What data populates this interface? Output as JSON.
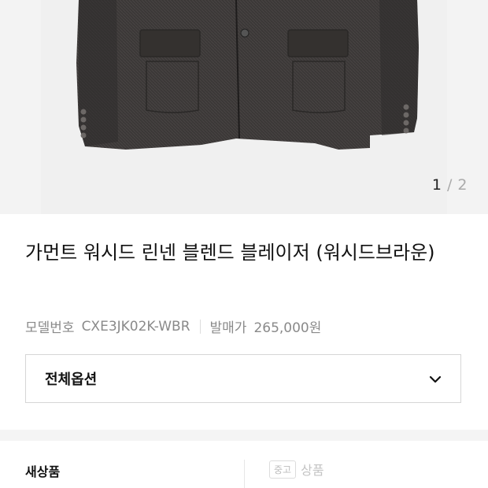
{
  "gallery": {
    "current": "1",
    "separator": "/",
    "total": "2"
  },
  "product": {
    "title": "가먼트 워시드 린넨 블렌드 블레이저 (워시드브라운)",
    "model_label": "모델번호",
    "model_value": "CXE3JK02K-WBR",
    "price_label": "발매가",
    "price_value": "265,000원"
  },
  "options": {
    "label": "전체옵션",
    "icon": "chevron-down-icon"
  },
  "condition_tabs": {
    "new_label": "새상품",
    "used_badge": "중고",
    "used_label": "상품"
  },
  "colors": {
    "jacket": "#3a3736",
    "background": "#f0f0f0",
    "muted_text": "#8a8a8a"
  }
}
